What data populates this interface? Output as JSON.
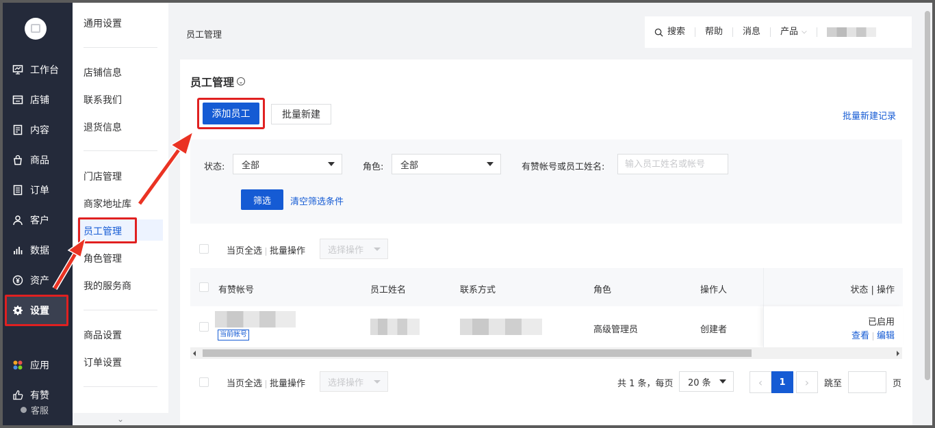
{
  "nav": {
    "items": [
      {
        "label": "工作台",
        "icon": "dashboard-icon"
      },
      {
        "label": "店铺",
        "icon": "store-icon"
      },
      {
        "label": "内容",
        "icon": "content-icon"
      },
      {
        "label": "商品",
        "icon": "bag-icon"
      },
      {
        "label": "订单",
        "icon": "order-icon"
      },
      {
        "label": "客户",
        "icon": "user-icon"
      },
      {
        "label": "数据",
        "icon": "chart-icon"
      },
      {
        "label": "资产",
        "icon": "yen-icon"
      },
      {
        "label": "设置",
        "icon": "gear-icon"
      },
      {
        "label": "应用",
        "icon": "apps-icon"
      },
      {
        "label": "有赞",
        "icon": "thumb-icon"
      }
    ],
    "service": "客服"
  },
  "submenu": {
    "items": [
      "通用设置",
      "店铺信息",
      "联系我们",
      "退货信息",
      "门店管理",
      "商家地址库",
      "员工管理",
      "角色管理",
      "我的服务商",
      "商品设置",
      "订单设置"
    ]
  },
  "header": {
    "breadcrumb": "员工管理",
    "search": "搜索",
    "help": "帮助",
    "messages": "消息",
    "product": "产品"
  },
  "page": {
    "title": "员工管理",
    "add_button": "添加员工",
    "batch_create": "批量新建",
    "batch_record": "批量新建记录"
  },
  "filter": {
    "status_label": "状态:",
    "status_value": "全部",
    "role_label": "角色:",
    "role_value": "全部",
    "account_label": "有赞帐号或员工姓名:",
    "account_placeholder": "输入员工姓名或帐号",
    "filter_button": "筛选",
    "clear_link": "清空筛选条件"
  },
  "bulk": {
    "select_all": "当页全选",
    "batch_op": "批量操作",
    "choose_op": "选择操作"
  },
  "table": {
    "columns": [
      "有赞帐号",
      "员工姓名",
      "联系方式",
      "角色",
      "操作人",
      "状态 | 操作"
    ],
    "rows": [
      {
        "tag": "当前帐号",
        "role": "高级管理员",
        "operator": "创建者",
        "status": "已启用",
        "view": "查看",
        "edit": "编辑"
      }
    ]
  },
  "pagination": {
    "summary": "共 1 条，每页",
    "page_size": "20 条",
    "current": "1",
    "jump_label": "跳至",
    "page_suffix": "页"
  },
  "colors": {
    "primary": "#155bd4",
    "nav_bg": "#242a3a",
    "highlight": "#e02020"
  }
}
